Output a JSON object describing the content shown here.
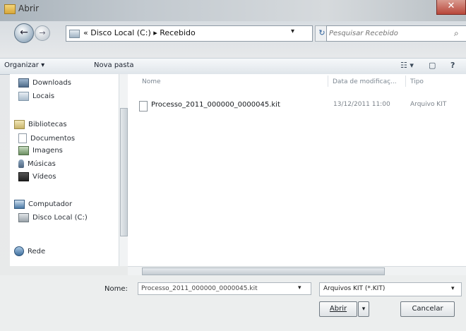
{
  "window": {
    "title": "Abrir",
    "close_glyph": "✕"
  },
  "nav": {
    "back_glyph": "←",
    "forward_glyph": "→",
    "address_text": "« Disco Local (C:) ▸ Recebido",
    "address_dropdown_glyph": "▾",
    "refresh_glyph": "↻",
    "search_placeholder": "Pesquisar Recebido",
    "search_icon_glyph": "⌕"
  },
  "toolbar": {
    "organize_label": "Organizar ▾",
    "new_folder_label": "Nova pasta",
    "view_icon_glyph": "☷ ▾",
    "preview_icon_glyph": "▢",
    "help_icon_glyph": "?"
  },
  "sidebar": {
    "items": [
      {
        "label": "Downloads",
        "icon": "downloads-icon"
      },
      {
        "label": "Locais",
        "icon": "places-icon"
      },
      {
        "label": "Bibliotecas",
        "icon": "library-icon"
      },
      {
        "label": "Documentos",
        "icon": "documents-icon"
      },
      {
        "label": "Imagens",
        "icon": "images-icon"
      },
      {
        "label": "Músicas",
        "icon": "music-icon"
      },
      {
        "label": "Vídeos",
        "icon": "videos-icon"
      },
      {
        "label": "Computador",
        "icon": "computer-icon"
      },
      {
        "label": "Disco Local (C:)",
        "icon": "drive-icon"
      },
      {
        "label": "Rede",
        "icon": "network-icon"
      }
    ]
  },
  "file_list": {
    "columns": [
      "Nome",
      "Data de modificaç...",
      "Tipo"
    ],
    "rows": [
      {
        "name": "Processo_2011_000000_0000045.kit",
        "date": "13/12/2011 11:00",
        "type": "Arquivo KIT"
      }
    ]
  },
  "bottom": {
    "name_label": "Nome:",
    "name_value": "Processo_2011_000000_0000045.kit",
    "name_dropdown_glyph": "▾",
    "type_filter": "Arquivos KIT (*.KIT)",
    "type_dropdown_glyph": "▾",
    "open_label": "Abrir",
    "open_split_glyph": "▾",
    "cancel_label": "Cancelar"
  },
  "colors": {
    "close_red": "#b8473a",
    "address_border": "#8e9aa5"
  }
}
